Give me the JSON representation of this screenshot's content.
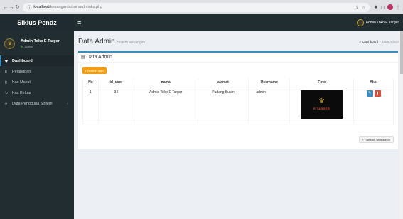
{
  "browser": {
    "url_host": "localhost",
    "url_path": "/keuangan/admin/adminku.php"
  },
  "sidebar": {
    "brand": "Siklus Pendz",
    "user_name": "Admin Toko E Targer",
    "user_status": "Admin",
    "items": [
      {
        "label": "Dashboard",
        "icon": "dashboard-icon"
      },
      {
        "label": "Pelanggan",
        "icon": "file-icon"
      },
      {
        "label": "Kas Masuk",
        "icon": "file-icon"
      },
      {
        "label": "Kas Keluar",
        "icon": "refresh-icon"
      },
      {
        "label": "Data Pengguna Sistem",
        "icon": "user-icon"
      }
    ]
  },
  "header": {
    "user_name": "Admin Toko E Targer"
  },
  "content": {
    "title": "Data Admin",
    "subtitle": "Sistem Keuangan",
    "breadcrumb": [
      "Dashboard",
      "Data Admin"
    ]
  },
  "box": {
    "title": "Data Admin",
    "add_button": "Tambah data",
    "add_button_bottom": "Tambah data admin",
    "columns": [
      "No",
      "id_user",
      "nama",
      "alamat",
      "Username",
      "Foto",
      "Aksi"
    ],
    "rows": [
      {
        "no": "1",
        "id_user": "34",
        "nama": "Admin Toko E Targer",
        "alamat": "Padang Bulan",
        "username": "admin",
        "foto_text": "E TARGER"
      }
    ]
  },
  "colors": {
    "sidebar_bg": "#222d32",
    "accent": "#3c8dbc",
    "warning": "#f39c12",
    "danger": "#dd4b39"
  }
}
